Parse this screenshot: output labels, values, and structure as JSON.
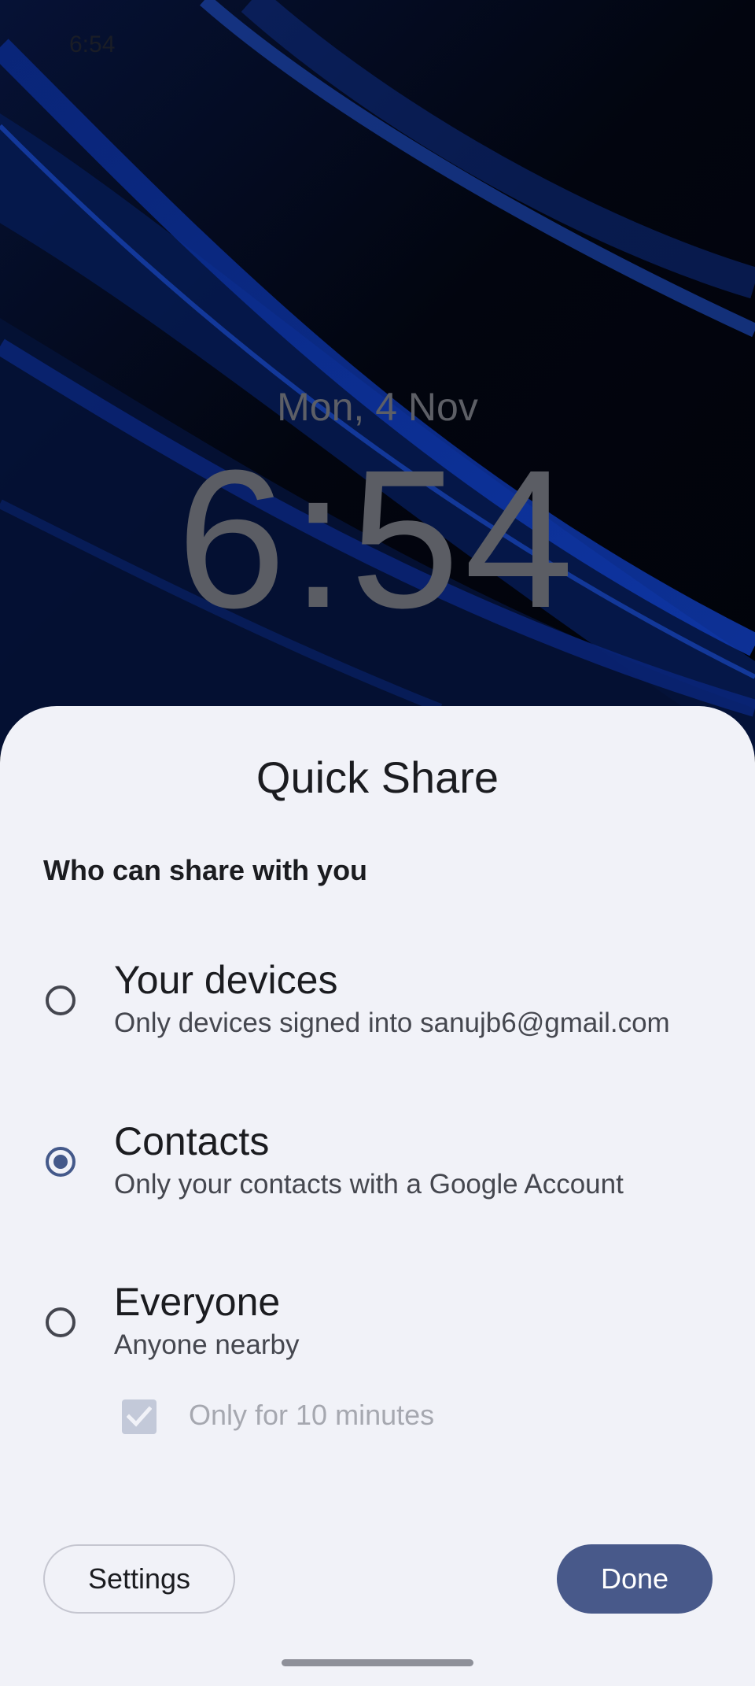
{
  "status_bar": {
    "time": "6:54"
  },
  "lock_screen": {
    "date": "Mon, 4 Nov",
    "time": "6:54"
  },
  "sheet": {
    "title": "Quick Share",
    "section_label": "Who can share with you",
    "options": [
      {
        "title": "Your devices",
        "subtitle": "Only devices signed into sanujb6@gmail.com",
        "selected": false
      },
      {
        "title": "Contacts",
        "subtitle": "Only your contacts with a Google Account",
        "selected": true
      },
      {
        "title": "Everyone",
        "subtitle": "Anyone nearby",
        "selected": false
      }
    ],
    "time_limit": {
      "label": "Only for 10 minutes",
      "checked": true,
      "enabled": false
    },
    "buttons": {
      "settings": "Settings",
      "done": "Done"
    }
  },
  "colors": {
    "accent": "#44598a",
    "sheet_background": "#f1f2f8",
    "done_button": "#48598a"
  }
}
